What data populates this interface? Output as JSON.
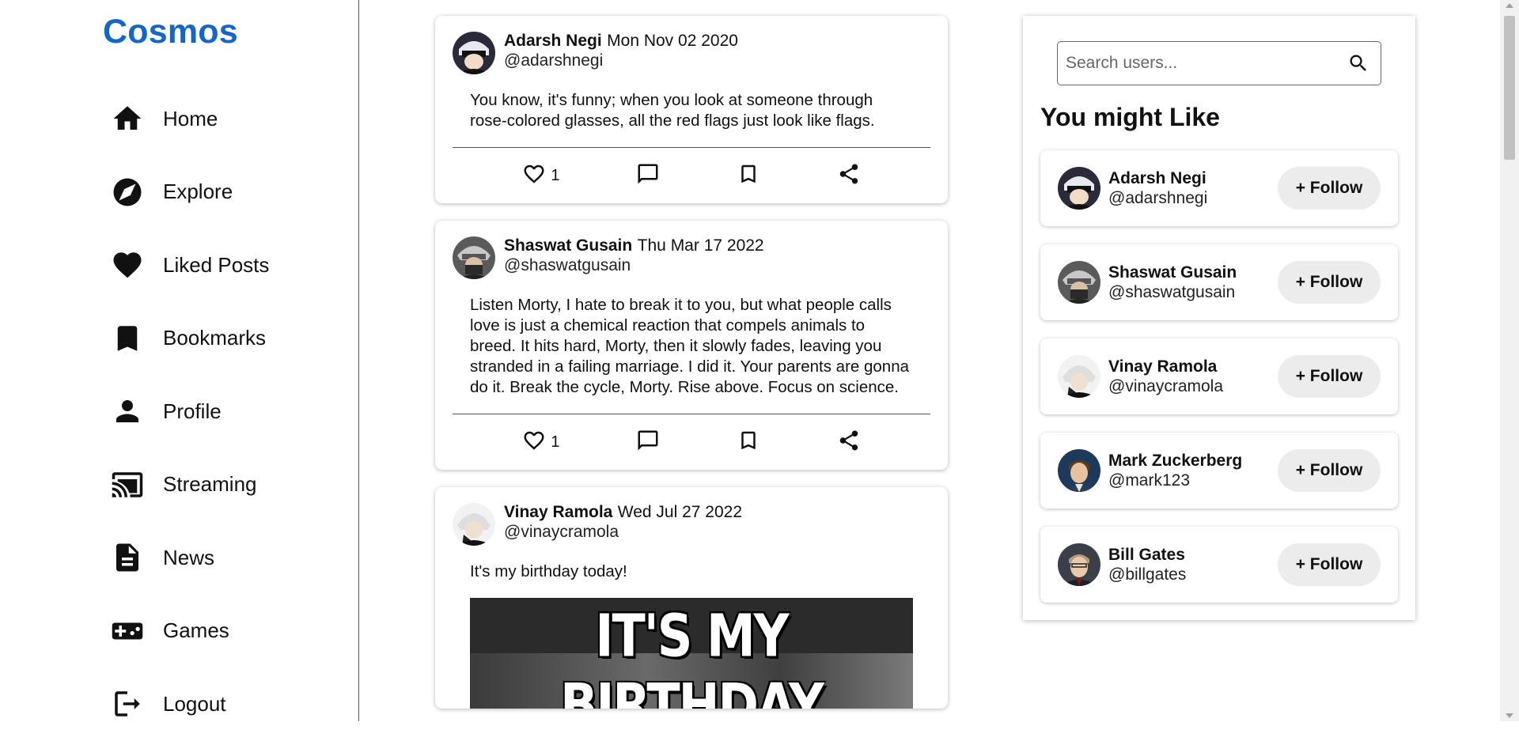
{
  "app": {
    "logo": "Cosmos",
    "accent": "#1666c5"
  },
  "nav": [
    {
      "label": "Home",
      "icon": "home-icon"
    },
    {
      "label": "Explore",
      "icon": "compass-icon"
    },
    {
      "label": "Liked Posts",
      "icon": "heart-icon"
    },
    {
      "label": "Bookmarks",
      "icon": "bookmark-icon"
    },
    {
      "label": "Profile",
      "icon": "person-icon"
    },
    {
      "label": "Streaming",
      "icon": "cast-icon"
    },
    {
      "label": "News",
      "icon": "article-icon"
    },
    {
      "label": "Games",
      "icon": "gamepad-icon"
    },
    {
      "label": "Logout",
      "icon": "logout-icon"
    }
  ],
  "posts": [
    {
      "name": "Adarsh Negi",
      "date": "Mon Nov 02 2020",
      "handle": "@adarshnegi",
      "text": "You know, it's funny; when you look at someone through rose-colored glasses, all the red flags just look like flags.",
      "likes": "1"
    },
    {
      "name": "Shaswat Gusain",
      "date": "Thu Mar 17 2022",
      "handle": "@shaswatgusain",
      "text": "Listen Morty, I hate to break it to you, but what people calls love is just a chemical reaction that compels animals to breed. It hits hard, Morty, then it slowly fades, leaving you stranded in a failing marriage. I did it. Your parents are gonna do it. Break the cycle, Morty. Rise above. Focus on science.",
      "likes": "1"
    },
    {
      "name": "Vinay Ramola",
      "date": "Wed Jul 27 2022",
      "handle": "@vinaycramola",
      "text": "It's my birthday today!",
      "image_text": "IT'S MY BIRTHDAY"
    }
  ],
  "search": {
    "placeholder": "Search users..."
  },
  "suggestions": {
    "title": "You might Like",
    "follow_label": "+ Follow",
    "users": [
      {
        "name": "Adarsh Negi",
        "handle": "@adarshnegi"
      },
      {
        "name": "Shaswat Gusain",
        "handle": "@shaswatgusain"
      },
      {
        "name": "Vinay Ramola",
        "handle": "@vinaycramola"
      },
      {
        "name": "Mark Zuckerberg",
        "handle": "@mark123"
      },
      {
        "name": "Bill Gates",
        "handle": "@billgates"
      }
    ]
  }
}
